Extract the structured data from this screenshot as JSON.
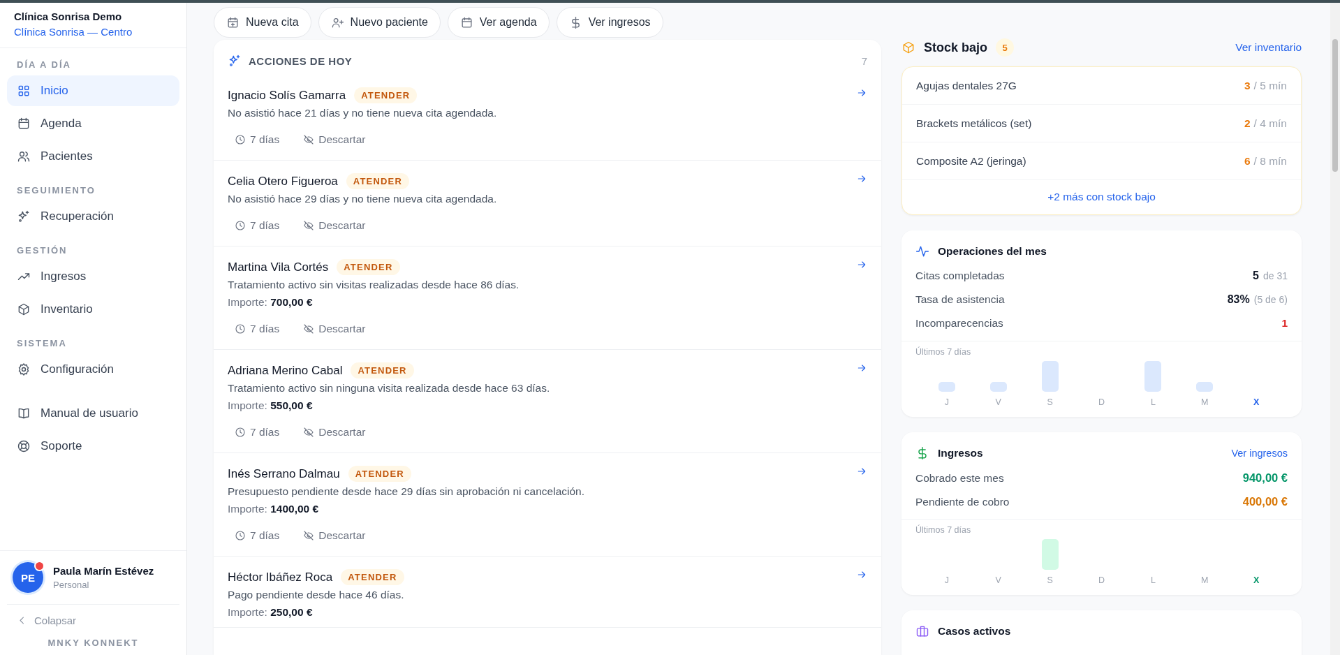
{
  "sidebar": {
    "brand": {
      "name": "Clínica Sonrisa Demo",
      "location": "Clínica Sonrisa — Centro"
    },
    "sections": [
      {
        "title": "DÍA A DÍA",
        "items": [
          {
            "label": "Inicio",
            "selected": true
          },
          {
            "label": "Agenda",
            "selected": false
          },
          {
            "label": "Pacientes",
            "selected": false
          }
        ]
      },
      {
        "title": "SEGUIMIENTO",
        "items": [
          {
            "label": "Recuperación",
            "selected": false
          }
        ]
      },
      {
        "title": "GESTIÓN",
        "items": [
          {
            "label": "Ingresos",
            "selected": false
          },
          {
            "label": "Inventario",
            "selected": false
          }
        ]
      },
      {
        "title": "SISTEMA",
        "items": [
          {
            "label": "Configuración",
            "selected": false
          }
        ]
      }
    ],
    "links": [
      {
        "label": "Manual de usuario",
        "selected": false
      },
      {
        "label": "Soporte",
        "selected": false
      }
    ],
    "user": {
      "initials": "PE",
      "name": "Paula Marín Estévez",
      "role": "Personal",
      "notification": true
    },
    "collapse": "Colapsar",
    "footer": "MNKY KONNEKT"
  },
  "quick_actions": [
    "Nueva cita",
    "Nuevo paciente",
    "Ver agenda",
    "Ver ingresos"
  ],
  "actions": {
    "title": "ACCIONES DE HOY",
    "count": "7",
    "items": [
      {
        "name": "Ignacio Solís Gamarra",
        "tag": "ATENDER",
        "description": "No asistió hace 21 días y no tiene nueva cita agendada.",
        "snooze": "7 días",
        "dismiss": "Descartar"
      },
      {
        "name": "Celia Otero Figueroa",
        "tag": "ATENDER",
        "description": "No asistió hace 29 días y no tiene nueva cita agendada.",
        "snooze": "7 días",
        "dismiss": "Descartar"
      },
      {
        "name": "Martina Vila Cortés",
        "tag": "ATENDER",
        "description": "Tratamiento activo sin visitas realizadas desde hace 86 días.",
        "amount": "Importe: **700,00 €**",
        "snooze": "7 días",
        "dismiss": "Descartar"
      },
      {
        "name": "Adriana Merino Cabal",
        "tag": "ATENDER",
        "description": "Tratamiento activo sin ninguna visita realizada desde hace 63 días.",
        "amount": "Importe: **550,00 €**",
        "snooze": "7 días",
        "dismiss": "Descartar"
      },
      {
        "name": "Inés Serrano Dalmau",
        "tag": "ATENDER",
        "description": "Presupuesto pendiente desde hace 29 días sin aprobación ni cancelación.",
        "amount": "Importe: **1400,00 €**",
        "snooze": "7 días",
        "dismiss": "Descartar"
      },
      {
        "name": "Héctor Ibáñez Roca",
        "tag": "ATENDER",
        "description": "Pago pendiente desde hace 46 días.",
        "amount": "Importe: **250,00 €**"
      }
    ]
  },
  "stock": {
    "title": "Stock bajo",
    "count": "5",
    "link": "Ver inventario",
    "items": [
      {
        "name": "Agujas dentales 27G",
        "quantity": "3",
        "minimum": "/ 5 mín"
      },
      {
        "name": "Brackets metálicos (set)",
        "quantity": "2",
        "minimum": "/ 4 mín"
      },
      {
        "name": "Composite A2 (jeringa)",
        "quantity": "6",
        "minimum": "/ 8 mín"
      }
    ],
    "more": "+2 más con stock bajo"
  },
  "operations": {
    "title": "Operaciones del mes",
    "rows": [
      {
        "label": "Citas completadas",
        "value": "5",
        "detail": "de 31",
        "kind": "default"
      },
      {
        "label": "Tasa de asistencia",
        "value": "83%",
        "detail": "(5 de 6)",
        "kind": "default"
      },
      {
        "label": "Incomparecencias",
        "value": "1",
        "kind": "alert"
      }
    ],
    "chart": {
      "caption": "Últimos 7 días",
      "days": [
        {
          "label": "J",
          "current": false
        },
        {
          "label": "V",
          "current": false
        },
        {
          "label": "S",
          "current": false
        },
        {
          "label": "D",
          "current": false
        },
        {
          "label": "L",
          "current": false
        },
        {
          "label": "M",
          "current": false
        },
        {
          "label": "X",
          "current": true
        }
      ]
    }
  },
  "income": {
    "title": "Ingresos",
    "link": "Ver ingresos",
    "rows": [
      {
        "label": "Cobrado este mes",
        "value": "940,00 €",
        "kind": "positive"
      },
      {
        "label": "Pendiente de cobro",
        "value": "400,00 €",
        "kind": "warning"
      }
    ],
    "chart": {
      "caption": "Últimos 7 días",
      "days": [
        {
          "label": "J",
          "current": false
        },
        {
          "label": "V",
          "current": false
        },
        {
          "label": "S",
          "current": false
        },
        {
          "label": "D",
          "current": false
        },
        {
          "label": "L",
          "current": false
        },
        {
          "label": "M",
          "current": false
        },
        {
          "label": "X",
          "current": true
        }
      ]
    }
  },
  "cases": {
    "title": "Casos activos"
  }
}
